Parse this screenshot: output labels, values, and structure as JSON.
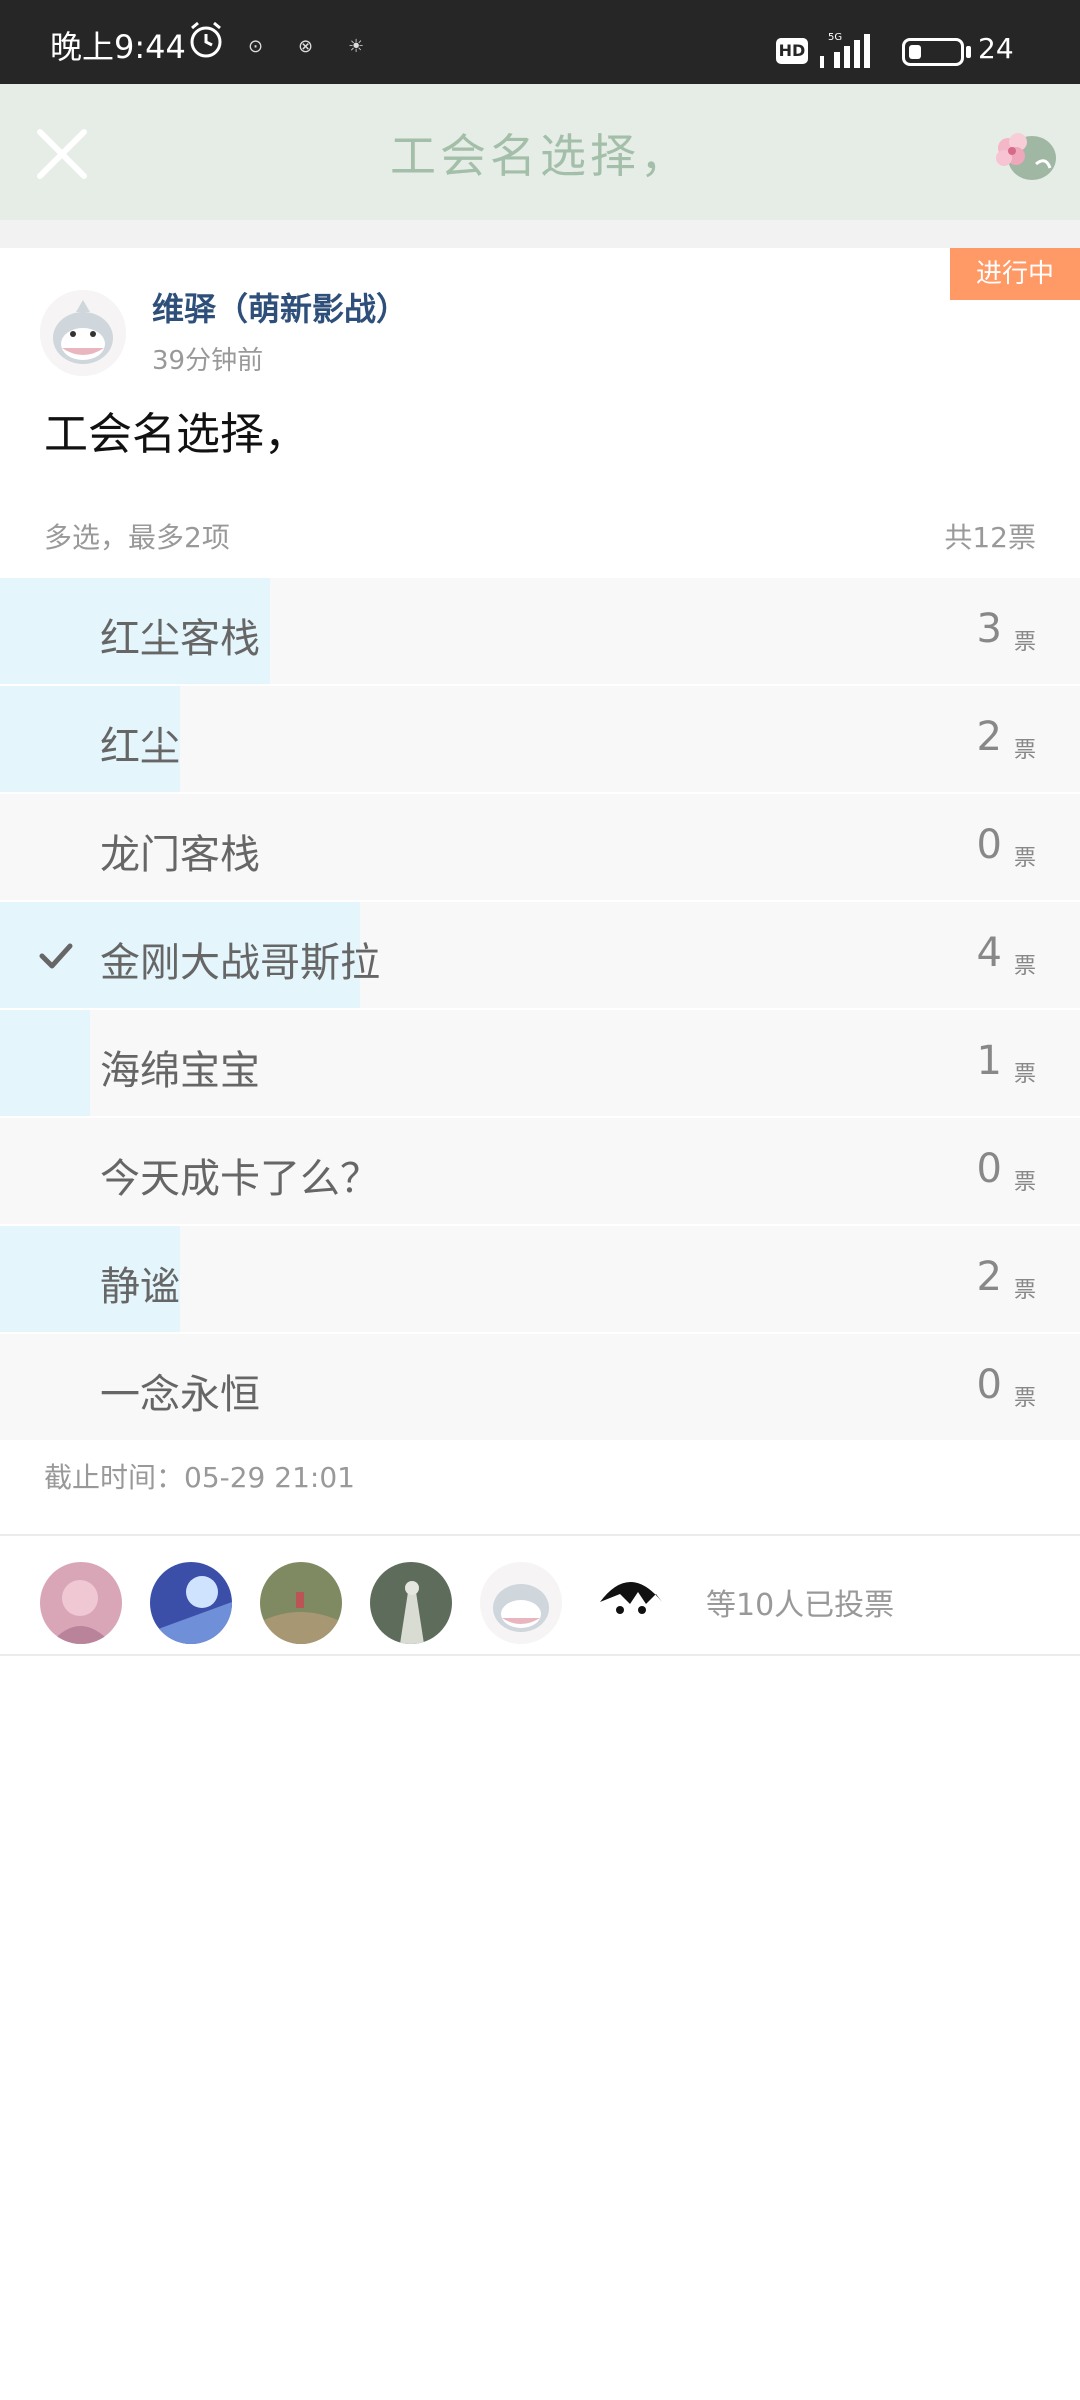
{
  "status_bar": {
    "time": "晚上9:44",
    "extra_1": "⊙",
    "extra_2": "⊗",
    "extra_3": "☀",
    "hd": "HD",
    "battery_pct": "24",
    "battery_level": 0.24
  },
  "header": {
    "title": "工会名选择，"
  },
  "post": {
    "status": "进行中",
    "author": "维驿（萌新影战）",
    "time": "39分钟前",
    "question": "工会名选择，",
    "rule": "多选，最多2项",
    "total": "共12票",
    "vote_unit": "票",
    "deadline": "截止时间：05-29 21:01",
    "voters_text": "等10人已投票"
  },
  "options": [
    {
      "label": "红尘客栈",
      "count": "3",
      "share": 0.25,
      "selected": false
    },
    {
      "label": "红尘",
      "count": "2",
      "share": 0.1667,
      "selected": false
    },
    {
      "label": "龙门客栈",
      "count": "0",
      "share": 0,
      "selected": false
    },
    {
      "label": "金刚大战哥斯拉",
      "count": "4",
      "share": 0.3333,
      "selected": true
    },
    {
      "label": "海绵宝宝",
      "count": "1",
      "share": 0.0833,
      "selected": false
    },
    {
      "label": "今天成卡了么？",
      "count": "0",
      "share": 0,
      "selected": false
    },
    {
      "label": "静谧",
      "count": "2",
      "share": 0.1667,
      "selected": false
    },
    {
      "label": "一念永恒",
      "count": "0",
      "share": 0,
      "selected": false
    }
  ],
  "colors": {
    "accent_fill": "#e4f5fb",
    "badge": "#ff9965",
    "header_bg": "#e6ede6",
    "author": "#2e4f7a"
  }
}
